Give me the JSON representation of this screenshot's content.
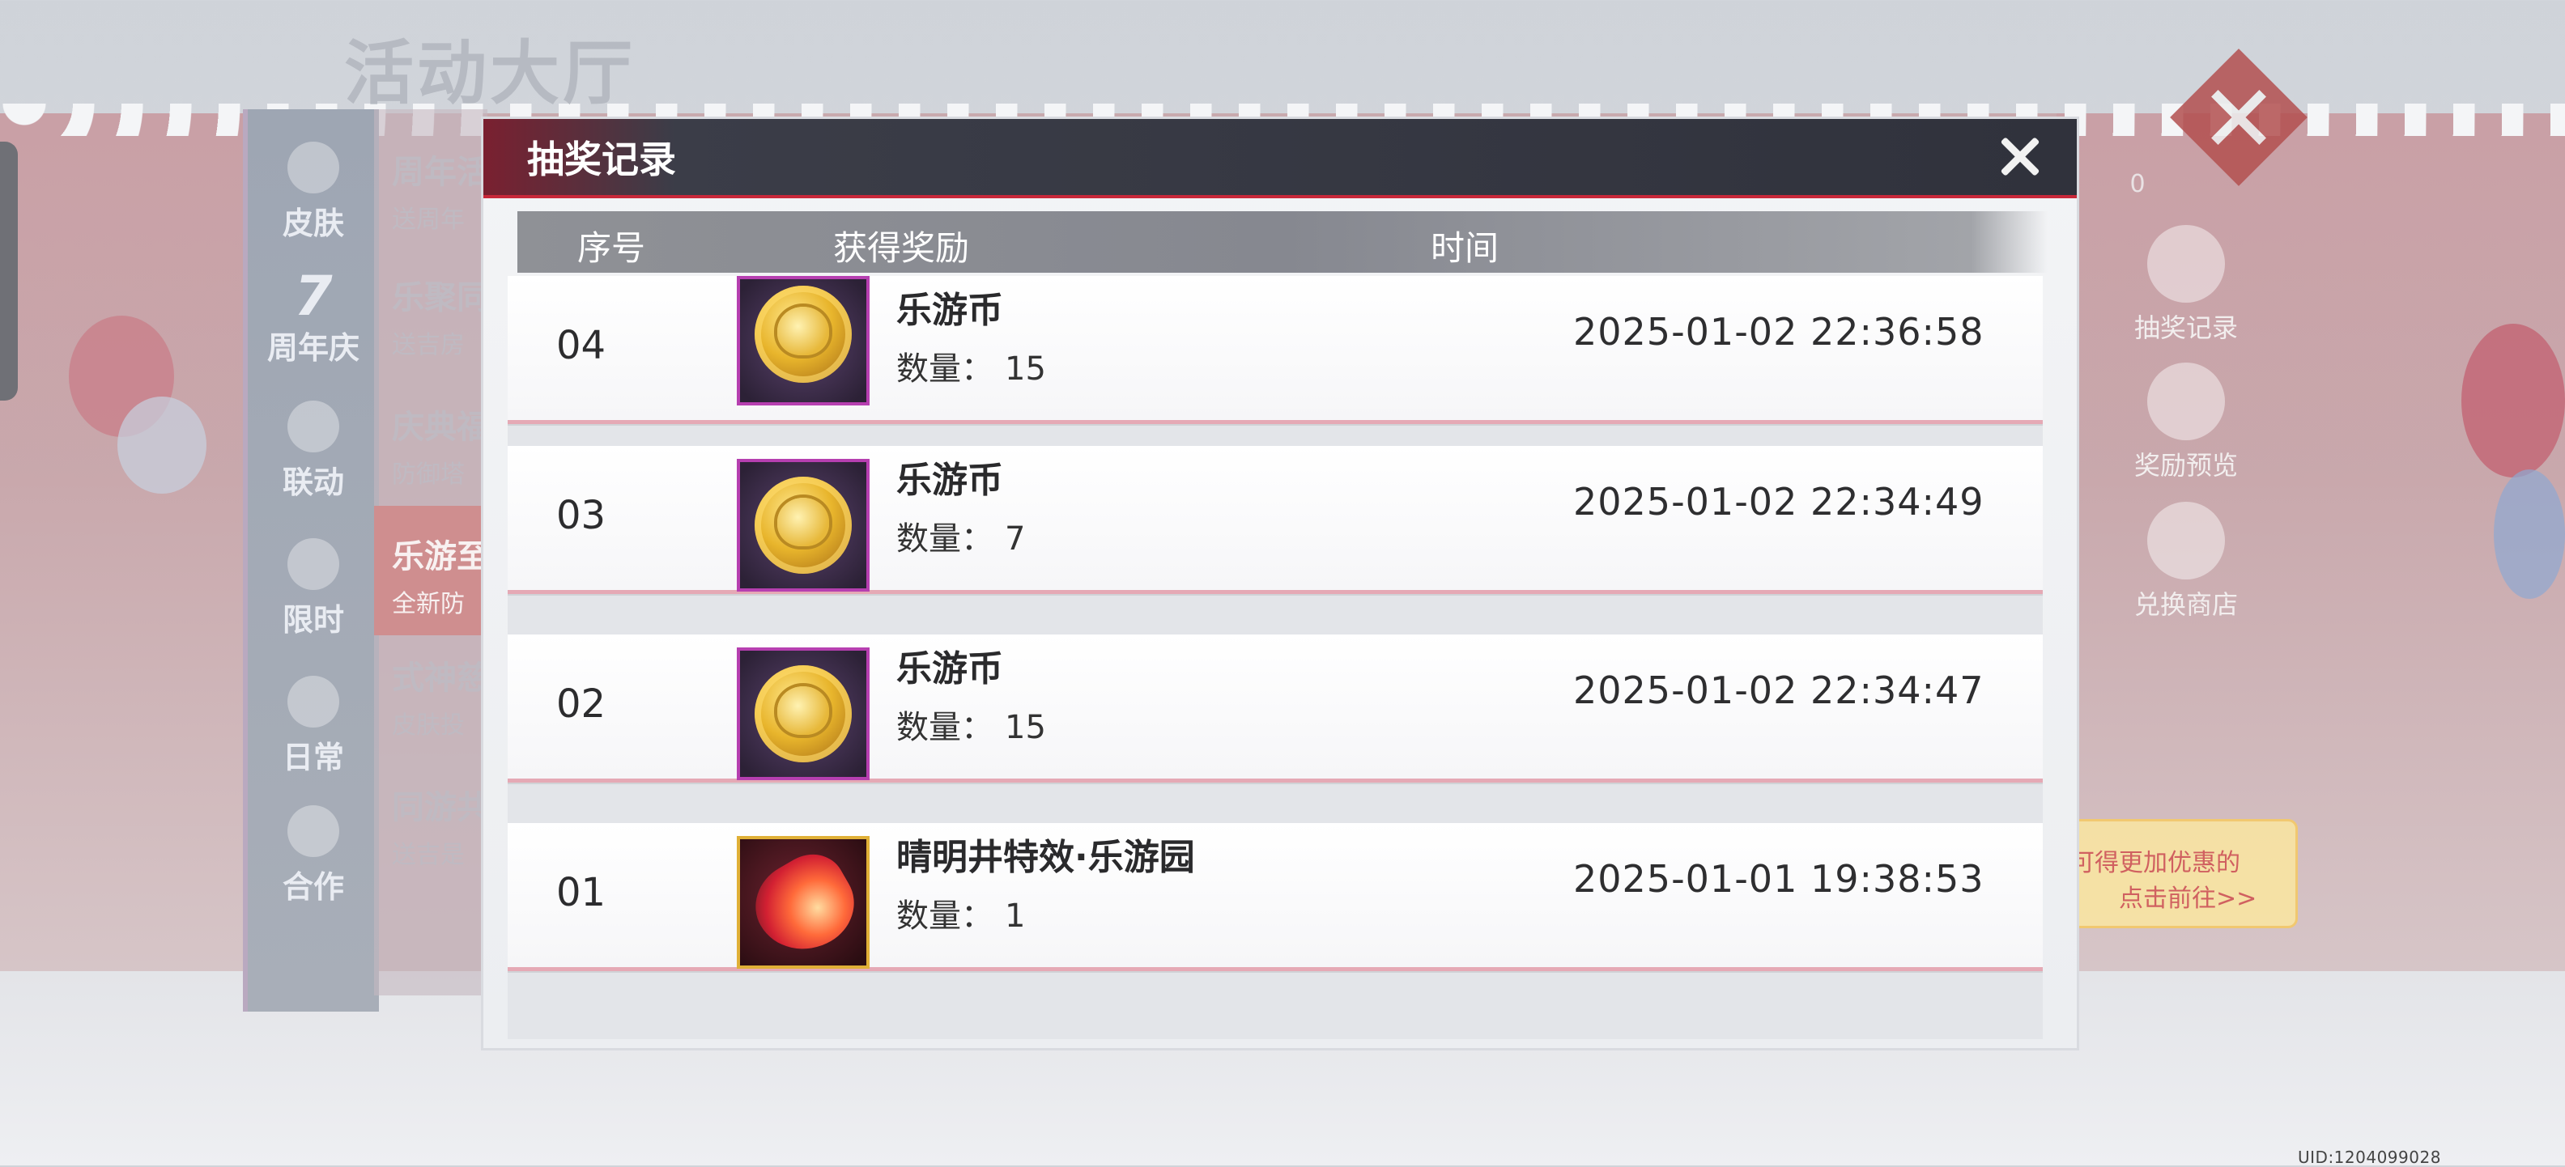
{
  "background": {
    "hall_title": "活动大厅",
    "nav": [
      {
        "label": "皮肤",
        "icon": "flower-icon"
      },
      {
        "label": "周年庆",
        "icon": "seven-badge-icon",
        "badge": "7"
      },
      {
        "label": "联动",
        "icon": "horn-icon"
      },
      {
        "label": "限时",
        "icon": "clock-icon"
      },
      {
        "label": "日常",
        "icon": "gift-icon"
      },
      {
        "label": "合作",
        "icon": "handshake-icon"
      }
    ],
    "sub_items": [
      {
        "title": "周年活",
        "desc": "送周年"
      },
      {
        "title": "乐聚同",
        "desc": "送吉房"
      },
      {
        "title": "庆典福",
        "desc": "防御塔"
      },
      {
        "title": "乐游至",
        "desc": "全新防"
      },
      {
        "title": "式神慈",
        "desc": "皮肤投"
      },
      {
        "title": "同游共",
        "desc": "送吉是"
      }
    ],
    "counter": "0",
    "side_buttons": [
      {
        "label": "抽奖记录",
        "icon": "cat-icon"
      },
      {
        "label": "奖励预览",
        "icon": "document-icon"
      },
      {
        "label": "兑换商店",
        "icon": "shop-icon"
      }
    ],
    "promo_line1": "可得更加优惠的",
    "promo_line2": "点击前往>>",
    "uid": "UID:1204099028"
  },
  "modal": {
    "title": "抽奖记录",
    "columns": {
      "seq": "序号",
      "reward": "获得奖励",
      "time": "时间"
    },
    "records": [
      {
        "seq": "04",
        "name": "乐游币",
        "qty_label": "数量：",
        "qty": "15",
        "time": "2025-01-02 22:36:58",
        "icon": "coin-icon"
      },
      {
        "seq": "03",
        "name": "乐游币",
        "qty_label": "数量：",
        "qty": "7",
        "time": "2025-01-02 22:34:49",
        "icon": "coin-icon"
      },
      {
        "seq": "02",
        "name": "乐游币",
        "qty_label": "数量：",
        "qty": "15",
        "time": "2025-01-02 22:34:47",
        "icon": "coin-icon"
      },
      {
        "seq": "01",
        "name": "晴明井特效·乐游园",
        "qty_label": "数量：",
        "qty": "1",
        "time": "2025-01-01 19:38:53",
        "icon": "meteor-effect-icon"
      }
    ]
  }
}
